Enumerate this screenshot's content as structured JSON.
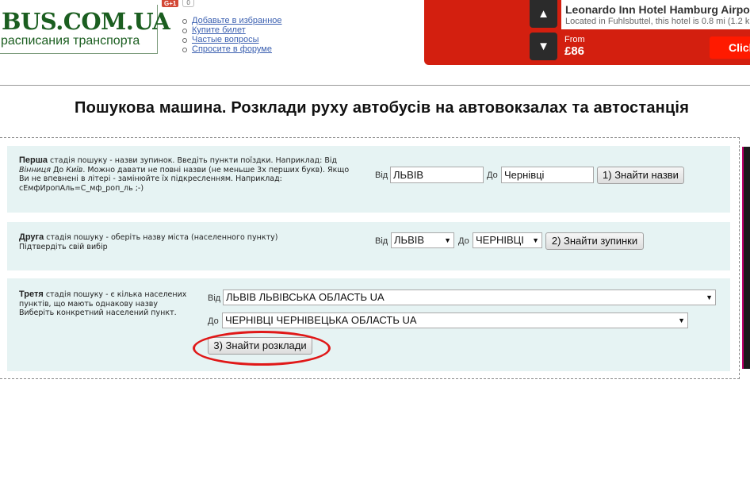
{
  "header": {
    "logo_title": "BUS.COM.UA",
    "logo_subtitle": "расписания транспорта",
    "gplus_label": "G+1",
    "gplus_count": "0",
    "links": [
      "Добавьте в избранное",
      "Купите билет",
      "Частые вопросы",
      "Спросите в форуме"
    ]
  },
  "ad": {
    "hotel": "Leonardo Inn Hotel Hamburg Airpo",
    "location": "Located in Fuhlsbuttel, this hotel is 0.8 mi (1.2 k",
    "from_label": "From",
    "price": "£86",
    "cta": "Click"
  },
  "page_title": "Пошукова машина. Розклади руху автобусів на автовокзалах та автостанція",
  "stage1": {
    "title": "Перша",
    "text": " стадія пошуку - назви зупинок. Введіть пункти поїздки. Наприклад: Від ",
    "ex_from": "Вінниця",
    "text2": " До ",
    "ex_to": "Київ",
    "text3": ". Можно давати не повні назви (не меньше 3х перших букв). Якщо Ви не впевнені в літері - замінюйте їх підкресленням. Наприклад: сЕмфИропАль=С_мф_роп_ль  ;-)",
    "from_label": "Від",
    "from_value": "ЛЬВІВ",
    "to_label": "До",
    "to_value": "Чернівці",
    "button": "1) Знайти назви"
  },
  "stage2": {
    "title": "Друга",
    "text": " стадія пошуку - оберіть назву міста (населенного пункту) Підтвердіть свій вибір",
    "from_label": "Від",
    "from_value": "ЛЬВІВ",
    "to_label": "До",
    "to_value": "ЧЕРНІВЦІ",
    "button": "2) Знайти зупинки"
  },
  "stage3": {
    "title": "Третя",
    "text": " стадія пошуку - є кілька населених пунктів, що мають однакову назву Виберіть конкретний населений пункт.",
    "from_label": "Від",
    "from_value": "ЛЬВІВ ЛЬВІВСЬКА ОБЛАСТЬ UA",
    "to_label": "До",
    "to_value": "ЧЕРНІВЦІ ЧЕРНІВЕЦЬКА ОБЛАСТЬ UA",
    "button": "3) Знайти розклади"
  },
  "colors": {
    "logo_green": "#1b5e20",
    "stage_bg": "#e6f3f3",
    "ad_red": "#d31f0f",
    "highlight": "#e01818"
  }
}
